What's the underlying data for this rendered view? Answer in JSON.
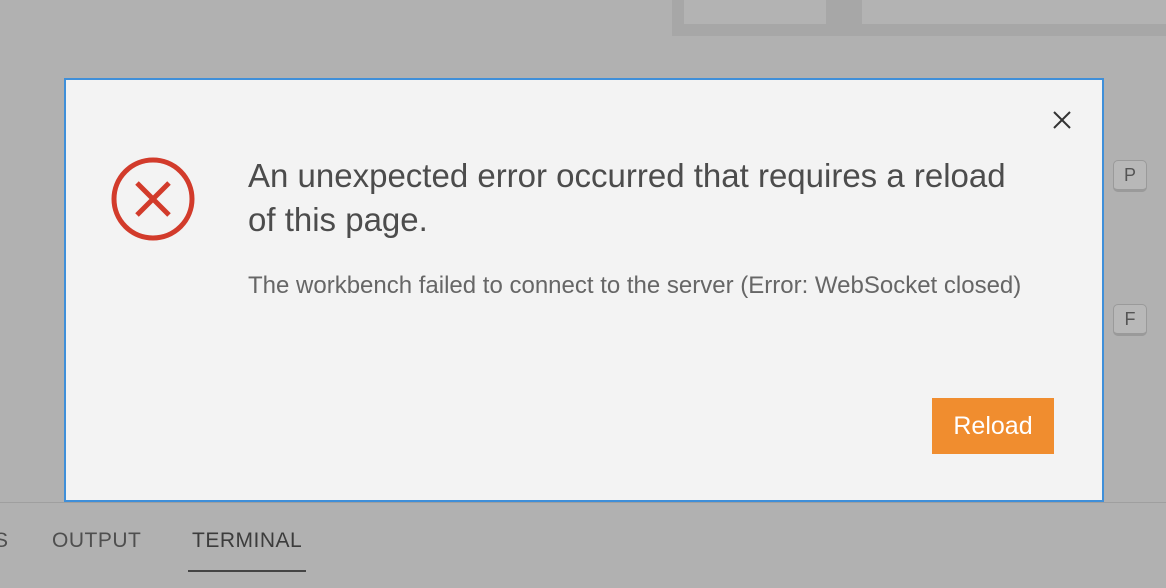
{
  "background": {
    "keycaps": [
      "P",
      "F"
    ],
    "panel_tabs": {
      "partial_label": "S",
      "output_label": "OUTPUT",
      "terminal_label": "TERMINAL",
      "active": "TERMINAL"
    }
  },
  "dialog": {
    "title": "An unexpected error occurred that requires a reload of this page.",
    "message": "The workbench failed to connect to the server (Error: WebSocket closed)",
    "reload_label": "Reload",
    "icons": {
      "status": "error-circle-x-icon",
      "close": "close-icon"
    },
    "colors": {
      "error": "#d23b2b",
      "button": "#f08d2f",
      "focus_border": "#3f8fd9"
    }
  }
}
